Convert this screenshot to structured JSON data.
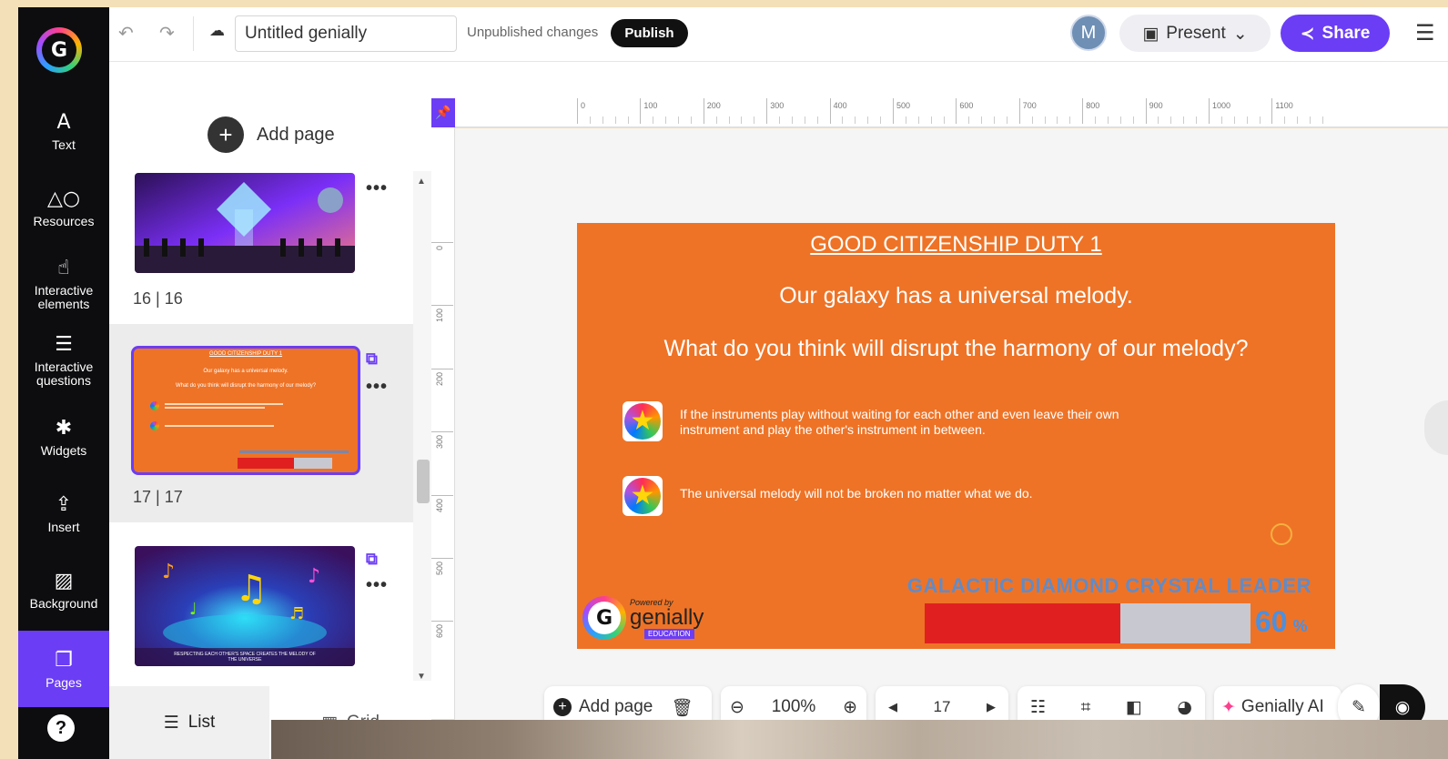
{
  "sidebar": {
    "items": [
      {
        "label": "Text",
        "icon": "text-icon",
        "glyph": "A"
      },
      {
        "label": "Resources",
        "icon": "resources-icon",
        "glyph": "△○"
      },
      {
        "label": "Interactive elements",
        "icon": "interactive-elements-icon",
        "glyph": "☝"
      },
      {
        "label": "Interactive questions",
        "icon": "interactive-questions-icon",
        "glyph": "☰"
      },
      {
        "label": "Widgets",
        "icon": "widgets-icon",
        "glyph": "✱"
      },
      {
        "label": "Insert",
        "icon": "insert-icon",
        "glyph": "⇪"
      },
      {
        "label": "Background",
        "icon": "background-icon",
        "glyph": "▨"
      },
      {
        "label": "Pages",
        "icon": "pages-icon",
        "glyph": "❐"
      }
    ],
    "active": "Pages",
    "help_glyph": "?"
  },
  "toolbar": {
    "undo_glyph": "↶",
    "redo_glyph": "↷",
    "cloud_glyph": "☁",
    "title_value": "Untitled genially",
    "unpublished": "Unpublished changes",
    "publish": "Publish",
    "avatar_initial": "M",
    "present": "Present",
    "present_glyph": "▣",
    "chevron": "⌄",
    "share": "Share",
    "share_glyph": "≺",
    "menu_glyph": "☰"
  },
  "pages_panel": {
    "add_page": "Add page",
    "plus": "+",
    "dots": "•••",
    "pin_glyph": "⧉",
    "pages": [
      {
        "label": "16 | 16"
      },
      {
        "label": "17 | 17",
        "selected": true
      },
      {
        "label": ""
      }
    ],
    "thumb_mini": {
      "title": "GOOD CITIZENSHIP DUTY 1",
      "line1": "Our galaxy has a universal melody.",
      "line2": "What do you think will disrupt the harmony of our melody?"
    },
    "thumb_caption": "RESPECTING EACH OTHER'S SPACE CREATES THE MELODY OF THE UNIVERSE",
    "list_tab": "List",
    "grid_tab": "Grid",
    "scroll_up": "▲",
    "scroll_down": "▼"
  },
  "ruler": {
    "h": [
      "0",
      "100",
      "200",
      "300",
      "400",
      "500",
      "600",
      "700",
      "800",
      "900",
      "1000",
      "1100"
    ],
    "v": [
      "0",
      "100",
      "200",
      "300",
      "400",
      "500",
      "600"
    ]
  },
  "slide": {
    "title": "GOOD CITIZENSHIP DUTY 1",
    "line1": "Our galaxy has a universal melody.",
    "line2": "What do you think will disrupt the harmony of our melody?",
    "option1": "If the instruments play without waiting for each other and even leave their own instrument and play the other's instrument in between.",
    "option2": "The universal melody will not be broken no matter what we do.",
    "star_glyph": "★",
    "leader_label": "GALACTIC DIAMOND CRYSTAL LEADER",
    "progress_value": 60,
    "progress_fill_fraction": 0.6,
    "progress_percent_sign": "%",
    "powered_by": "Powered by",
    "brand": "genially",
    "edu": "EDUCATION",
    "logo_glyph": "G"
  },
  "bottom_toolbar": {
    "add_page": "Add page",
    "plus": "+",
    "trash_glyph": "🗑",
    "zoom_out_glyph": "⊖",
    "zoom": "100%",
    "zoom_in_glyph": "⊕",
    "prev_glyph": "◀",
    "page": "17",
    "next_glyph": "▶",
    "checklist_glyph": "☷",
    "fit_glyph": "⌗",
    "split_glyph": "◧",
    "palette_glyph": "◕",
    "ai_glyph": "✦",
    "ai": "Genially AI",
    "pencil_glyph": "✎",
    "eye_glyph": "◉"
  },
  "colors": {
    "accent": "#6b3df5",
    "slide_bg": "#ee7326",
    "progress_fill": "#e02020",
    "leader_text": "#4a90e2",
    "sidebar_bg": "#0d0d0f"
  }
}
